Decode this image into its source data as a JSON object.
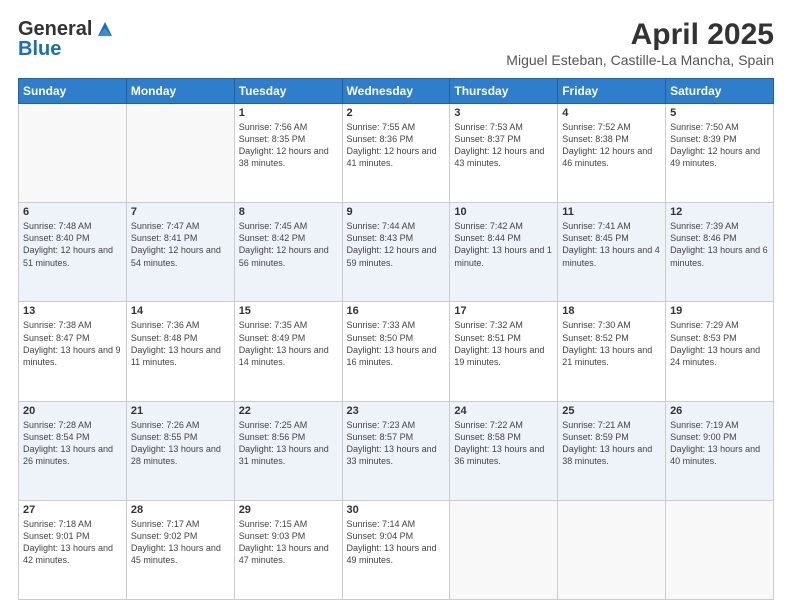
{
  "header": {
    "logo_general": "General",
    "logo_blue": "Blue",
    "month_title": "April 2025",
    "location": "Miguel Esteban, Castille-La Mancha, Spain"
  },
  "weekdays": [
    "Sunday",
    "Monday",
    "Tuesday",
    "Wednesday",
    "Thursday",
    "Friday",
    "Saturday"
  ],
  "weeks": [
    [
      {
        "day": "",
        "info": ""
      },
      {
        "day": "",
        "info": ""
      },
      {
        "day": "1",
        "info": "Sunrise: 7:56 AM\nSunset: 8:35 PM\nDaylight: 12 hours and 38 minutes."
      },
      {
        "day": "2",
        "info": "Sunrise: 7:55 AM\nSunset: 8:36 PM\nDaylight: 12 hours and 41 minutes."
      },
      {
        "day": "3",
        "info": "Sunrise: 7:53 AM\nSunset: 8:37 PM\nDaylight: 12 hours and 43 minutes."
      },
      {
        "day": "4",
        "info": "Sunrise: 7:52 AM\nSunset: 8:38 PM\nDaylight: 12 hours and 46 minutes."
      },
      {
        "day": "5",
        "info": "Sunrise: 7:50 AM\nSunset: 8:39 PM\nDaylight: 12 hours and 49 minutes."
      }
    ],
    [
      {
        "day": "6",
        "info": "Sunrise: 7:48 AM\nSunset: 8:40 PM\nDaylight: 12 hours and 51 minutes."
      },
      {
        "day": "7",
        "info": "Sunrise: 7:47 AM\nSunset: 8:41 PM\nDaylight: 12 hours and 54 minutes."
      },
      {
        "day": "8",
        "info": "Sunrise: 7:45 AM\nSunset: 8:42 PM\nDaylight: 12 hours and 56 minutes."
      },
      {
        "day": "9",
        "info": "Sunrise: 7:44 AM\nSunset: 8:43 PM\nDaylight: 12 hours and 59 minutes."
      },
      {
        "day": "10",
        "info": "Sunrise: 7:42 AM\nSunset: 8:44 PM\nDaylight: 13 hours and 1 minute."
      },
      {
        "day": "11",
        "info": "Sunrise: 7:41 AM\nSunset: 8:45 PM\nDaylight: 13 hours and 4 minutes."
      },
      {
        "day": "12",
        "info": "Sunrise: 7:39 AM\nSunset: 8:46 PM\nDaylight: 13 hours and 6 minutes."
      }
    ],
    [
      {
        "day": "13",
        "info": "Sunrise: 7:38 AM\nSunset: 8:47 PM\nDaylight: 13 hours and 9 minutes."
      },
      {
        "day": "14",
        "info": "Sunrise: 7:36 AM\nSunset: 8:48 PM\nDaylight: 13 hours and 11 minutes."
      },
      {
        "day": "15",
        "info": "Sunrise: 7:35 AM\nSunset: 8:49 PM\nDaylight: 13 hours and 14 minutes."
      },
      {
        "day": "16",
        "info": "Sunrise: 7:33 AM\nSunset: 8:50 PM\nDaylight: 13 hours and 16 minutes."
      },
      {
        "day": "17",
        "info": "Sunrise: 7:32 AM\nSunset: 8:51 PM\nDaylight: 13 hours and 19 minutes."
      },
      {
        "day": "18",
        "info": "Sunrise: 7:30 AM\nSunset: 8:52 PM\nDaylight: 13 hours and 21 minutes."
      },
      {
        "day": "19",
        "info": "Sunrise: 7:29 AM\nSunset: 8:53 PM\nDaylight: 13 hours and 24 minutes."
      }
    ],
    [
      {
        "day": "20",
        "info": "Sunrise: 7:28 AM\nSunset: 8:54 PM\nDaylight: 13 hours and 26 minutes."
      },
      {
        "day": "21",
        "info": "Sunrise: 7:26 AM\nSunset: 8:55 PM\nDaylight: 13 hours and 28 minutes."
      },
      {
        "day": "22",
        "info": "Sunrise: 7:25 AM\nSunset: 8:56 PM\nDaylight: 13 hours and 31 minutes."
      },
      {
        "day": "23",
        "info": "Sunrise: 7:23 AM\nSunset: 8:57 PM\nDaylight: 13 hours and 33 minutes."
      },
      {
        "day": "24",
        "info": "Sunrise: 7:22 AM\nSunset: 8:58 PM\nDaylight: 13 hours and 36 minutes."
      },
      {
        "day": "25",
        "info": "Sunrise: 7:21 AM\nSunset: 8:59 PM\nDaylight: 13 hours and 38 minutes."
      },
      {
        "day": "26",
        "info": "Sunrise: 7:19 AM\nSunset: 9:00 PM\nDaylight: 13 hours and 40 minutes."
      }
    ],
    [
      {
        "day": "27",
        "info": "Sunrise: 7:18 AM\nSunset: 9:01 PM\nDaylight: 13 hours and 42 minutes."
      },
      {
        "day": "28",
        "info": "Sunrise: 7:17 AM\nSunset: 9:02 PM\nDaylight: 13 hours and 45 minutes."
      },
      {
        "day": "29",
        "info": "Sunrise: 7:15 AM\nSunset: 9:03 PM\nDaylight: 13 hours and 47 minutes."
      },
      {
        "day": "30",
        "info": "Sunrise: 7:14 AM\nSunset: 9:04 PM\nDaylight: 13 hours and 49 minutes."
      },
      {
        "day": "",
        "info": ""
      },
      {
        "day": "",
        "info": ""
      },
      {
        "day": "",
        "info": ""
      }
    ]
  ]
}
